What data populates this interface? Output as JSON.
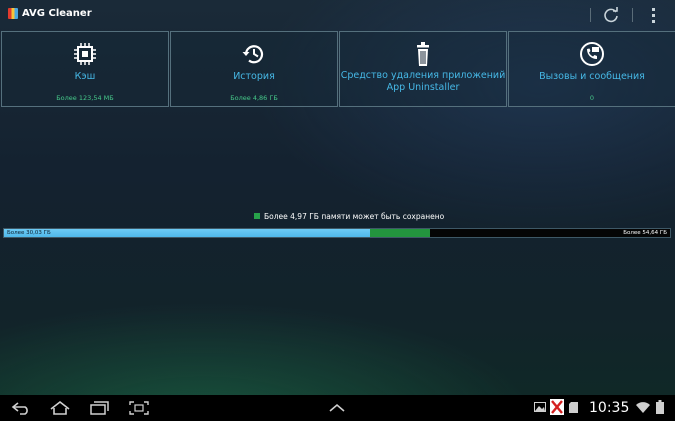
{
  "action_bar": {
    "title": "AVG Cleaner",
    "refresh_icon": "refresh-icon",
    "overflow_icon": "overflow-menu-icon"
  },
  "tiles": [
    {
      "label": "Кэш",
      "value": "Более 123,54 МБ",
      "icon": "chip-icon"
    },
    {
      "label": "История",
      "value": "Более 4,86 ГБ",
      "icon": "history-icon"
    },
    {
      "label": "Средство удаления приложений\nApp Uninstaller",
      "value": "",
      "icon": "trash-icon"
    },
    {
      "label": "Вызовы и сообщения",
      "value": "0",
      "icon": "call-message-icon"
    }
  ],
  "storage": {
    "legend": "Более 4,97 ГБ памяти может быть сохранено",
    "left_label": "Более 30,03 ГБ",
    "right_label": "Более 54,64 ГБ",
    "used_fraction": 0.55,
    "saveable_fraction": 0.09,
    "colors": {
      "used": "#4fb8ea",
      "saveable": "#23953e",
      "free": "#050505"
    }
  },
  "system_bar": {
    "time": "10:35",
    "icons": [
      "back-icon",
      "home-icon",
      "recent-apps-icon",
      "screenshot-icon",
      "up-arrow-icon",
      "gallery-icon",
      "usb-debug-icon",
      "sd-card-icon",
      "wifi-icon",
      "battery-icon"
    ]
  }
}
